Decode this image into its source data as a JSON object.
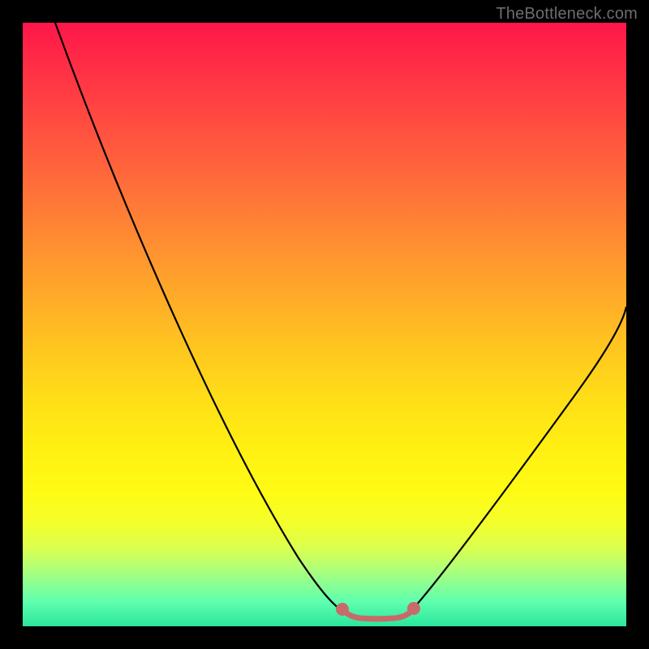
{
  "watermark": "TheBottleneck.com",
  "chart_data": {
    "type": "line",
    "title": "",
    "xlabel": "",
    "ylabel": "",
    "xlim": [
      0,
      100
    ],
    "ylim": [
      0,
      100
    ],
    "series": [
      {
        "name": "bottleneck-curve",
        "x": [
          5,
          10,
          15,
          20,
          25,
          30,
          35,
          40,
          45,
          50,
          52,
          55,
          58,
          60,
          62,
          65,
          70,
          75,
          80,
          85,
          90,
          95,
          100
        ],
        "y": [
          100,
          90,
          80,
          70,
          60,
          50,
          40,
          30,
          20,
          8,
          3,
          0.5,
          0.5,
          0.5,
          0.5,
          3,
          10,
          18,
          26,
          34,
          42,
          48,
          53
        ]
      },
      {
        "name": "valley-marker",
        "x": [
          52,
          53,
          54,
          55,
          56,
          57,
          58,
          59,
          60,
          61,
          62,
          63
        ],
        "y": [
          2,
          1,
          0.8,
          0.7,
          0.6,
          0.6,
          0.6,
          0.6,
          0.7,
          0.8,
          1,
          2
        ]
      }
    ],
    "colors": {
      "curve": "#000000",
      "valley_marker": "#c96a6a",
      "background_top": "#ff164a",
      "background_bottom": "#2be69a"
    }
  }
}
